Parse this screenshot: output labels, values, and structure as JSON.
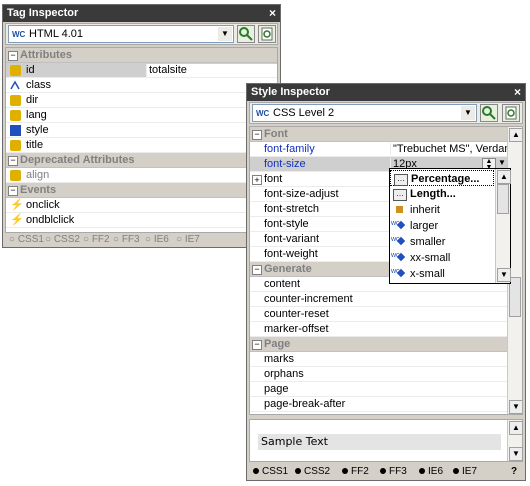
{
  "tag_inspector": {
    "title": "Tag Inspector",
    "close_glyph": "×",
    "doctype": "HTML 4.01",
    "doctype_prefix": "WC",
    "categories": {
      "attributes": "Attributes",
      "deprecated": "Deprecated Attributes",
      "events": "Events"
    },
    "rows": [
      {
        "name": "id",
        "value": "totalsite"
      },
      {
        "name": "class",
        "value": ""
      },
      {
        "name": "dir",
        "value": ""
      },
      {
        "name": "lang",
        "value": ""
      },
      {
        "name": "style",
        "value": ""
      },
      {
        "name": "title",
        "value": ""
      }
    ],
    "deprecated_rows": [
      {
        "name": "align",
        "value": ""
      }
    ],
    "event_rows": [
      {
        "name": "onclick"
      },
      {
        "name": "ondblclick"
      }
    ],
    "status": [
      "CSS1",
      "CSS2",
      "FF2",
      "FF3",
      "IE6",
      "IE7"
    ]
  },
  "style_inspector": {
    "title": "Style Inspector",
    "close_glyph": "×",
    "css_level": "CSS Level 2",
    "css_prefix": "WC",
    "categories": {
      "font": "Font",
      "generate": "Generate",
      "page": "Page"
    },
    "font_rows": [
      {
        "name": "font-family",
        "value": "\"Trebuchet MS\", Verdan..."
      },
      {
        "name": "font-size",
        "value": "12px"
      },
      {
        "name": "font",
        "value": ""
      },
      {
        "name": "font-size-adjust",
        "value": ""
      },
      {
        "name": "font-stretch",
        "value": ""
      },
      {
        "name": "font-style",
        "value": ""
      },
      {
        "name": "font-variant",
        "value": ""
      },
      {
        "name": "font-weight",
        "value": ""
      }
    ],
    "generate_rows": [
      {
        "name": "content"
      },
      {
        "name": "counter-increment"
      },
      {
        "name": "counter-reset"
      },
      {
        "name": "marker-offset"
      }
    ],
    "page_rows": [
      {
        "name": "marks"
      },
      {
        "name": "orphans"
      },
      {
        "name": "page"
      },
      {
        "name": "page-break-after"
      }
    ],
    "dropdown": [
      "Percentage...",
      "Length...",
      "inherit",
      "larger",
      "smaller",
      "xx-small",
      "x-small"
    ],
    "preview_text": "Sample Text",
    "status": [
      "CSS1",
      "CSS2",
      "FF2",
      "FF3",
      "IE6",
      "IE7"
    ],
    "help_glyph": "?"
  }
}
